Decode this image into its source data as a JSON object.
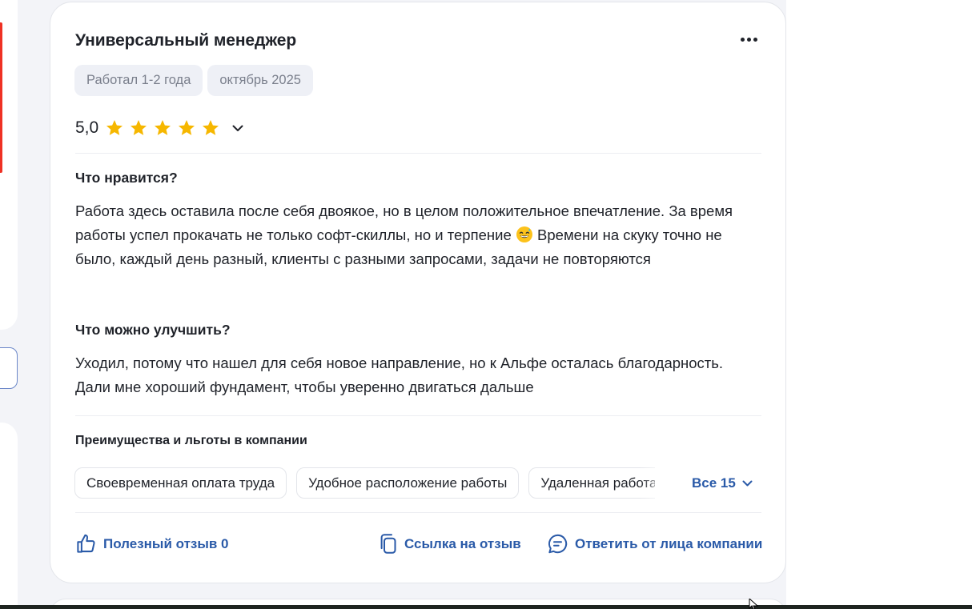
{
  "review": {
    "title": "Универсальный менеджер",
    "tags": [
      "Работал 1-2 года",
      "октябрь 2025"
    ],
    "rating": {
      "value_text": "5,0",
      "stars": 5,
      "max_stars": 5
    },
    "likes": {
      "title": "Что нравится?",
      "text_before_emoji": "Работа здесь оставила после себя двоякое, но в целом положительное впечатление. За время работы успел прокачать не только софт-скиллы, но и терпение ",
      "emoji": "smiling-face-with-sweat-emoji",
      "text_after_emoji": " Времени на скуку точно не было, каждый день разный, клиенты с разными запросами, задачи не повторяются"
    },
    "improve": {
      "title": "Что можно улучшить?",
      "text": "Уходил, потому что нашел для себя новое направление, но к Альфе осталась благодарность. Дали мне хороший фундамент, чтобы уверенно двигаться дальше"
    },
    "benefits": {
      "title": "Преимущества и льготы в компании",
      "items": [
        "Своевременная оплата труда",
        "Удобное расположение работы",
        "Удаленная работа"
      ],
      "all_label": "Все 15"
    },
    "actions": {
      "helpful_label": "Полезный отзыв 0",
      "link_label": "Ссылка на отзыв",
      "reply_label": "Ответить от лица компании"
    }
  },
  "icons": {
    "more": "more-horizontal-icon",
    "star": "star-icon",
    "chevron": "chevron-down-icon",
    "thumb": "thumbs-up-icon",
    "copy": "copy-link-icon",
    "reply": "chat-bubble-icon"
  },
  "colors": {
    "accent": "#2a5aa8",
    "star": "#f6b700",
    "brand_red": "#ef3124",
    "tag_bg": "#eef0f6"
  }
}
